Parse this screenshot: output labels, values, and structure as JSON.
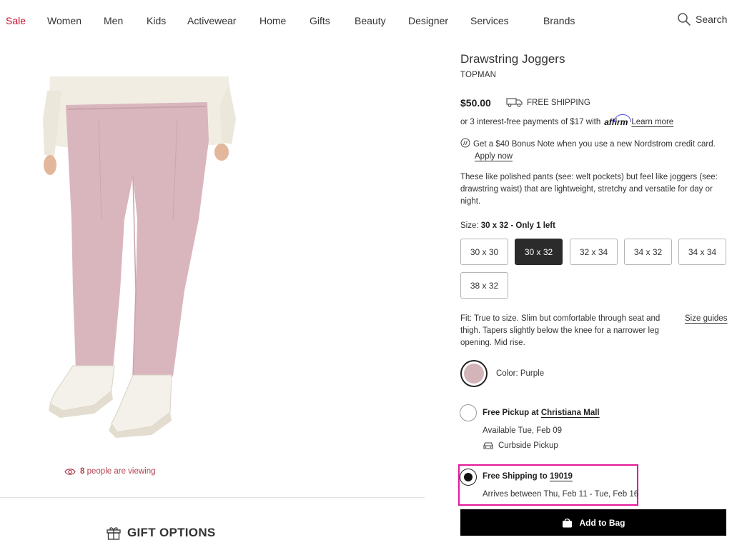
{
  "nav": {
    "items": [
      "Sale",
      "Women",
      "Men",
      "Kids",
      "Activewear",
      "Home",
      "Gifts",
      "Beauty",
      "Designer",
      "Services",
      "Brands"
    ],
    "search_label": "Search"
  },
  "product": {
    "title": "Drawstring Joggers",
    "brand": "TOPMAN",
    "price": "$50.00",
    "shipping_badge": "FREE SHIPPING",
    "installments_prefix": "or 3 interest-free payments of $17 with",
    "affirm_logo": "affirm",
    "learn_more": "Learn more",
    "bonus_text": "Get a $40 Bonus Note when you use a new Nordstrom credit card.",
    "apply_now": "Apply now",
    "description": "These like polished pants (see: welt pockets) but feel like joggers (see: drawstring waist) that are lightweight, stretchy and versatile for day or night.",
    "color_hex": "#d3b4b9"
  },
  "size": {
    "label_prefix": "Size:",
    "selected_text": "30 x 32 - Only 1 left",
    "options": [
      "30 x 30",
      "30 x 32",
      "32 x 34",
      "34 x 32",
      "34 x 34",
      "38 x 32"
    ],
    "selected": "30 x 32"
  },
  "fit": {
    "text": "Fit: True to size. Slim but comfortable through seat and thigh. Tapers slightly below the knee for a narrower leg opening. Mid rise.",
    "size_guides": "Size guides"
  },
  "color": {
    "label": "Color: Purple"
  },
  "pickup": {
    "prefix": "Free Pickup at",
    "store": "Christiana Mall",
    "availability": "Available Tue, Feb 09",
    "curbside": "Curbside Pickup"
  },
  "shipping": {
    "prefix": "Free Shipping to",
    "zip": "19019",
    "arrival": "Arrives between Thu, Feb 11 - Tue, Feb 16",
    "highlight_color": "#e5189a"
  },
  "left": {
    "viewing_count": "8",
    "viewing_text": "people are viewing",
    "gift_options": "GIFT OPTIONS"
  },
  "cart": {
    "add_to_bag": "Add to Bag"
  }
}
